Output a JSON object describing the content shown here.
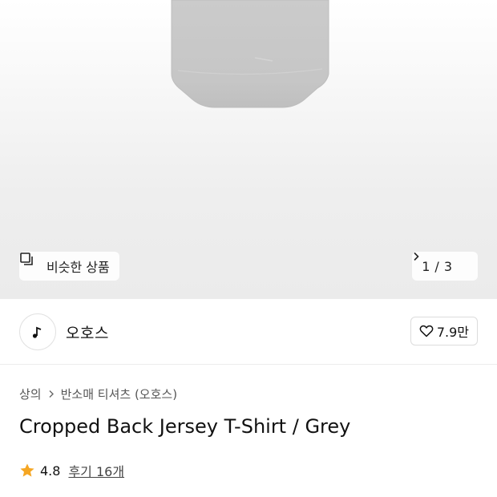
{
  "gallery": {
    "similar_label": "비슷한 상품",
    "pager_current": "1",
    "pager_separator": "/",
    "pager_total": "3"
  },
  "brand": {
    "name": "오호스",
    "likes": "7.9만"
  },
  "breadcrumb": {
    "items": [
      "상의",
      "반소매 티셔츠 (오호스)"
    ]
  },
  "product": {
    "title": "Cropped Back Jersey T-Shirt / Grey",
    "rating": "4.8",
    "reviews_label": "후기 16개"
  },
  "colors": {
    "star": "#f5a623",
    "shirt": "#c9c9c9"
  }
}
